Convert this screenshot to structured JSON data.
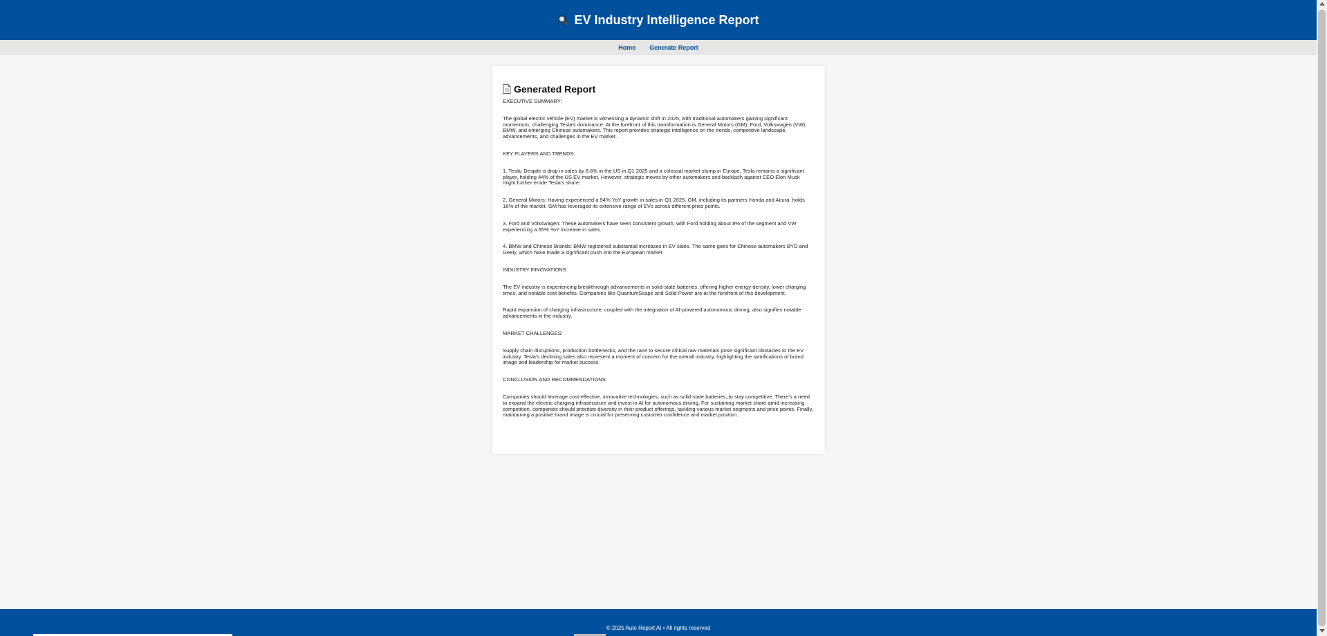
{
  "header": {
    "title": "EV Industry Intelligence Report",
    "icon": "magnifier-icon"
  },
  "nav": {
    "items": [
      "Home",
      "Generate Report"
    ]
  },
  "report": {
    "heading": "Generated Report",
    "heading_icon": "document-icon",
    "paragraphs": [
      "EXECUTIVE SUMMARY:",
      "The global electric vehicle (EV) market is witnessing a dynamic shift in 2025, with traditional automakers gaining significant momentum, challenging Tesla's dominance. At the forefront of this transformation is General Motors (GM), Ford, Volkswagen (VW), BMW, and emerging Chinese automakers. This report provides strategic intelligence on the trends, competitive landscape, advancements, and challenges in the EV market.",
      "KEY PLAYERS AND TRENDS:",
      "1. Tesla: Despite a drop in sales by 8.6% in the US in Q1 2025 and a colossal market slump in Europe, Tesla remains a significant player, holding 44% of the US EV market. However, strategic moves by other automakers and backlash against CEO Elon Musk might further erode Tesla's share.",
      "2. General Motors: Having experienced a 94% YoY growth in sales in Q1 2025, GM, including its partners Honda and Acura, holds 16% of the market. GM has leveraged its extensive range of EVs across different price points.",
      "3. Ford and Volkswagen: These automakers have seen consistent growth, with Ford holding about 8% of the segment and VW experiencing a 55% YoY increase in sales.",
      "4. BMW and Chinese Brands: BMW registered substantial increases in EV sales. The same goes for Chinese automakers BYD and Geely, which have made a significant push into the European market.",
      "INDUSTRY INNOVATIONS:",
      "The EV industry is experiencing breakthrough advancements in solid-state batteries, offering higher energy density, lower charging times, and notable cost benefits. Companies like QuantumScape and Solid Power are at the forefront of this development.",
      "Rapid expansion of charging infrastructure, coupled with the integration of AI-powered autonomous driving, also signifies notable advancements in the industry.",
      "MARKET CHALLENGES:",
      "Supply chain disruptions, production bottlenecks, and the race to secure critical raw materials pose significant obstacles to the EV industry. Tesla's declining sales also represent a moment of concern for the overall industry, highlighting the ramifications of brand image and leadership for market success.",
      "CONCLUSION AND RECOMMENDATIONS:",
      "Companies should leverage cost-effective, innovative technologies, such as solid-state batteries, to stay competitive. There's a need to expand the electric charging infrastructure and invest in AI for autonomous driving. For sustaining market share amid increasing competition, companies should prioritize diversity in their product offerings, tackling various market segments and price points. Finally, maintaining a positive brand image is crucial for preserving customer confidence and market position."
    ]
  },
  "footer": {
    "text": "© 2025 Auto Report AI • All rights reserved"
  }
}
